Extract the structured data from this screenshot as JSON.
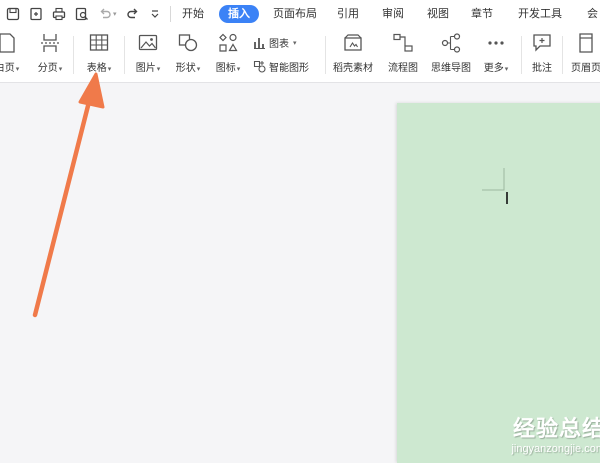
{
  "tabs": [
    {
      "label": "开始"
    },
    {
      "label": "插入"
    },
    {
      "label": "页面布局"
    },
    {
      "label": "引用"
    },
    {
      "label": "审阅"
    },
    {
      "label": "视图"
    },
    {
      "label": "章节"
    },
    {
      "label": "开发工具"
    },
    {
      "label": "会"
    }
  ],
  "ribbon": {
    "blank_page": "白页",
    "page_break": "分页",
    "table": "表格",
    "picture": "图片",
    "shape": "形状",
    "icons": "图标",
    "chart": "图表",
    "smart_art": "智能图形",
    "material": "稻壳素材",
    "flowchart": "流程图",
    "mindmap": "思维导图",
    "more": "更多",
    "comment": "批注",
    "header_footer": "页眉页"
  },
  "watermark": {
    "title": "经验总结",
    "url": "jingyanzongjie.com"
  },
  "colors": {
    "accent": "#3b82f6",
    "page_bg": "#cde8d0",
    "arrow": "#f07a4a"
  }
}
